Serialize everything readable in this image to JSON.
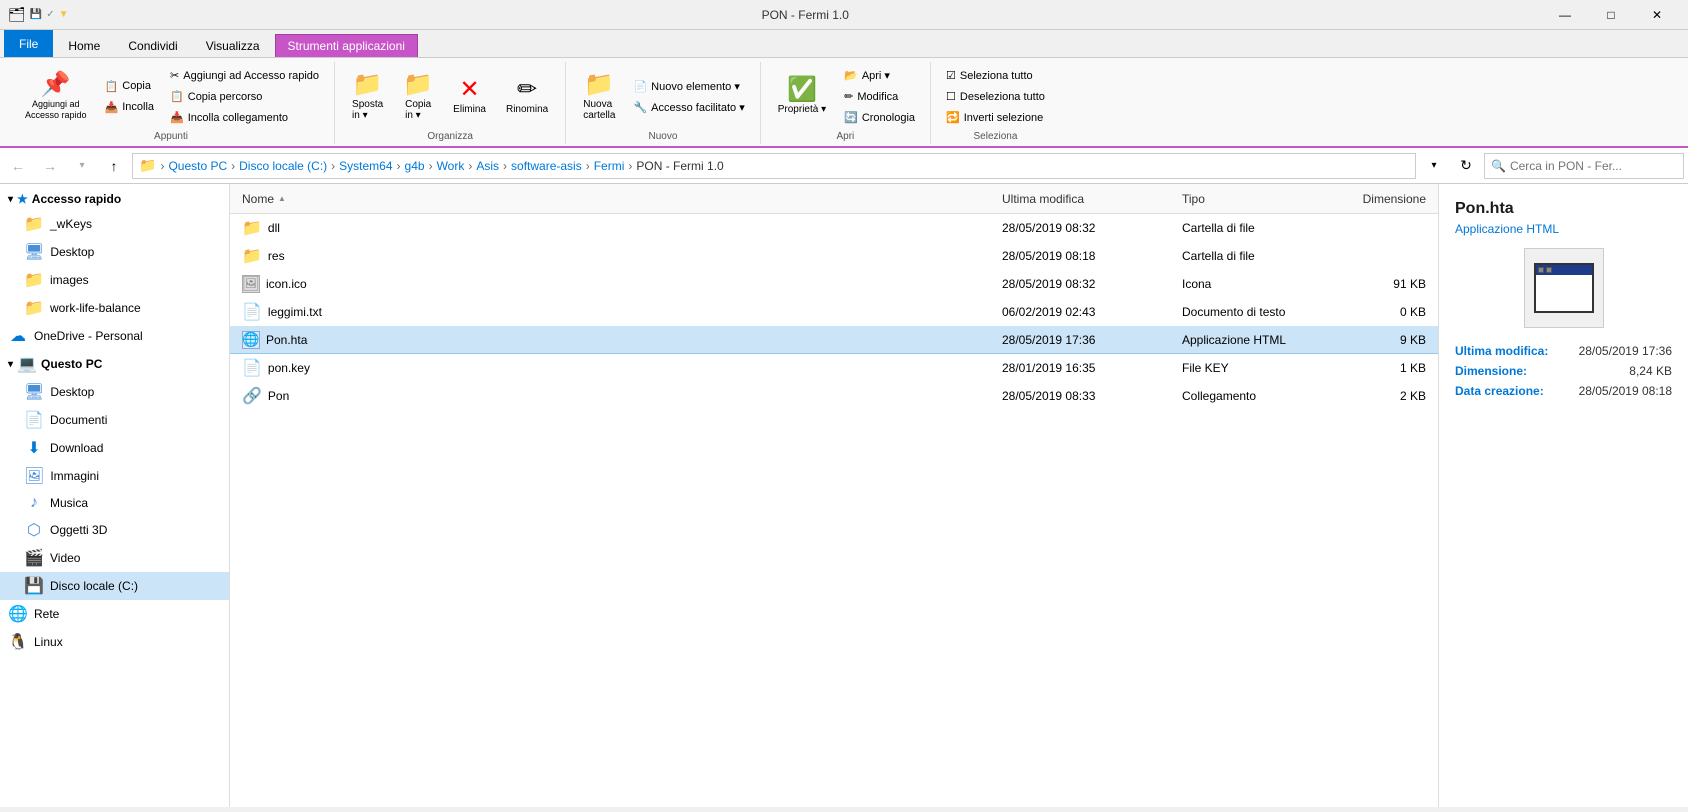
{
  "titlebar": {
    "title": "PON - Fermi 1.0",
    "buttons": {
      "minimize": "—",
      "maximize": "□",
      "close": "✕"
    }
  },
  "ribbon": {
    "tabs": [
      "File",
      "Home",
      "Condividi",
      "Visualizza",
      "Strumenti applicazioni"
    ],
    "active_tab": "Strumenti applicazioni",
    "groups": {
      "appunti": {
        "label": "Appunti",
        "items": [
          "Aggiungi ad Accesso rapido",
          "Copia",
          "Incolla",
          "Taglia",
          "Copia percorso",
          "Incolla collegamento"
        ]
      },
      "organizza": {
        "label": "Organizza",
        "items": [
          "Sposta in",
          "Copia in",
          "Elimina",
          "Rinomina"
        ]
      },
      "nuovo": {
        "label": "Nuovo",
        "items": [
          "Nuova cartella",
          "Nuovo elemento",
          "Accesso facilitato"
        ]
      },
      "apri": {
        "label": "Apri",
        "items": [
          "Proprietà",
          "Apri",
          "Modifica",
          "Cronologia"
        ]
      },
      "seleziona": {
        "label": "Seleziona",
        "items": [
          "Seleziona tutto",
          "Deseleziona tutto",
          "Inverti selezione"
        ]
      }
    }
  },
  "addressbar": {
    "breadcrumb": [
      {
        "label": "Questo PC",
        "type": "normal"
      },
      {
        "label": "Disco locale (C:)",
        "type": "normal"
      },
      {
        "label": "System64",
        "type": "normal"
      },
      {
        "label": "g4b",
        "type": "normal"
      },
      {
        "label": "Work",
        "type": "normal"
      },
      {
        "label": "Asis",
        "type": "normal"
      },
      {
        "label": "software-asis",
        "type": "normal"
      },
      {
        "label": "Fermi",
        "type": "normal"
      },
      {
        "label": "PON - Fermi 1.0",
        "type": "current"
      }
    ],
    "search_placeholder": "Cerca in PON - Fer..."
  },
  "sidebar": {
    "quick_access": {
      "label": "Accesso rapido",
      "items": [
        {
          "label": "_wKeys",
          "icon": "folder"
        },
        {
          "label": "Desktop",
          "icon": "blue-folder"
        },
        {
          "label": "images",
          "icon": "folder"
        },
        {
          "label": "work-life-balance",
          "icon": "folder"
        }
      ]
    },
    "onedrive": {
      "label": "OneDrive - Personal",
      "icon": "onedrive"
    },
    "questo_pc": {
      "label": "Questo PC",
      "items": [
        {
          "label": "Desktop",
          "icon": "blue-folder"
        },
        {
          "label": "Documenti",
          "icon": "docs"
        },
        {
          "label": "Download",
          "icon": "download"
        },
        {
          "label": "Immagini",
          "icon": "images"
        },
        {
          "label": "Musica",
          "icon": "music"
        },
        {
          "label": "Oggetti 3D",
          "icon": "objects3d"
        },
        {
          "label": "Video",
          "icon": "video"
        },
        {
          "label": "Disco locale (C:)",
          "icon": "drive",
          "selected": true
        }
      ]
    },
    "rete": {
      "label": "Rete",
      "icon": "network"
    },
    "linux": {
      "label": "Linux",
      "icon": "linux"
    }
  },
  "columns": {
    "nome": "Nome",
    "ultima_modifica": "Ultima modifica",
    "tipo": "Tipo",
    "dimensione": "Dimensione"
  },
  "files": [
    {
      "name": "dll",
      "date": "28/05/2019 08:32",
      "type": "Cartella di file",
      "size": "",
      "icon": "folder"
    },
    {
      "name": "res",
      "date": "28/05/2019 08:18",
      "type": "Cartella di file",
      "size": "",
      "icon": "folder"
    },
    {
      "name": "icon.ico",
      "date": "28/05/2019 08:32",
      "type": "Icona",
      "size": "91 KB",
      "icon": "ico"
    },
    {
      "name": "leggimi.txt",
      "date": "06/02/2019 02:43",
      "type": "Documento di testo",
      "size": "0 KB",
      "icon": "txt"
    },
    {
      "name": "Pon.hta",
      "date": "28/05/2019 17:36",
      "type": "Applicazione HTML",
      "size": "9 KB",
      "icon": "hta",
      "selected": true
    },
    {
      "name": "pon.key",
      "date": "28/01/2019 16:35",
      "type": "File KEY",
      "size": "1 KB",
      "icon": "key"
    },
    {
      "name": "Pon",
      "date": "28/05/2019 08:33",
      "type": "Collegamento",
      "size": "2 KB",
      "icon": "link"
    }
  ],
  "details": {
    "filename": "Pon.hta",
    "type": "Applicazione HTML",
    "ultima_modifica_label": "Ultima modifica:",
    "ultima_modifica_value": "28/05/2019 17:36",
    "dimensione_label": "Dimensione:",
    "dimensione_value": "8,24 KB",
    "data_creazione_label": "Data creazione:",
    "data_creazione_value": "28/05/2019 08:18"
  }
}
